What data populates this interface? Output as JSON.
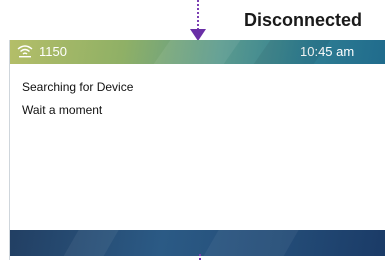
{
  "callout": {
    "text": "Disconnected"
  },
  "status_bar": {
    "extension": "1150",
    "time": "10:45 am",
    "icon": "wifi-icon"
  },
  "content": {
    "line1": "Searching for Device",
    "line2": "Wait a moment"
  },
  "colors": {
    "indicator": "#7b3fb3",
    "status_bar_start": "#b4be68",
    "status_bar_end": "#1f6a8c",
    "softkey_bar": "#2b5a85"
  }
}
